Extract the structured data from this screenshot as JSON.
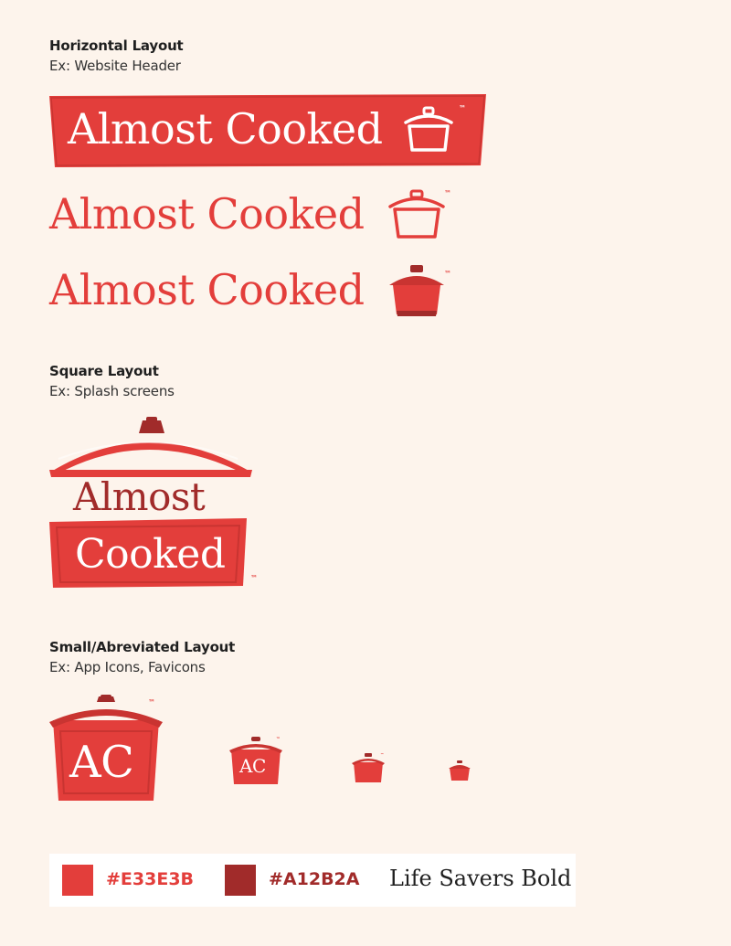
{
  "colors": {
    "primary": "#E33E3B",
    "dark": "#A12B2A",
    "background": "#fdf4ec"
  },
  "brand": {
    "name": "Almost Cooked",
    "word1": "Almost",
    "word2": "Cooked",
    "abbr": "AC",
    "tm": "™"
  },
  "sections": {
    "horizontal": {
      "title": "Horizontal Layout",
      "subtitle": "Ex: Website Header"
    },
    "square": {
      "title": "Square Layout",
      "subtitle": "Ex: Splash screens"
    },
    "small": {
      "title": "Small/Abreviated Layout",
      "subtitle": "Ex: App Icons, Favicons"
    }
  },
  "palette": {
    "primary_hex": "#E33E3B",
    "dark_hex": "#A12B2A",
    "font_name": "Life Savers Bold"
  },
  "icons": [
    "pot-outline-icon",
    "pot-filled-icon",
    "ac-pot-icon"
  ]
}
